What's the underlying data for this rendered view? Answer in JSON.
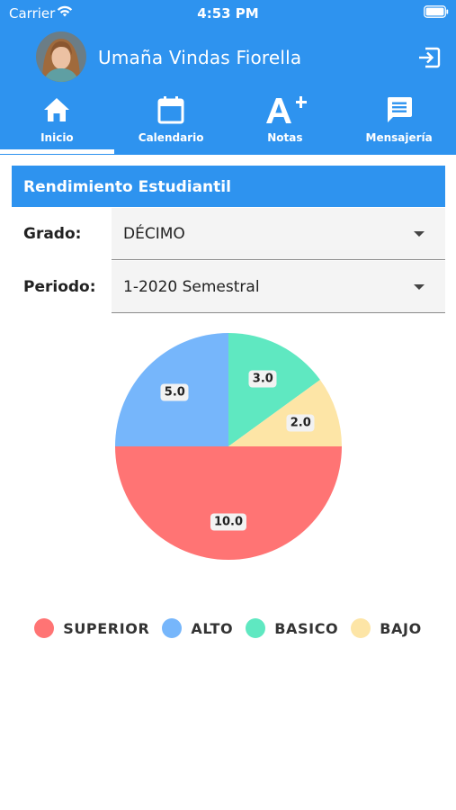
{
  "status_bar": {
    "carrier": "Carrier",
    "time": "4:53 PM"
  },
  "header": {
    "user_name": "Umaña Vindas Fiorella"
  },
  "tabs": [
    {
      "label": "Inicio",
      "icon": "home-icon",
      "active": true
    },
    {
      "label": "Calendario",
      "icon": "calendar-icon",
      "active": false
    },
    {
      "label": "Notas",
      "icon": "grades-icon",
      "active": false
    },
    {
      "label": "Mensajería",
      "icon": "message-icon",
      "active": false
    }
  ],
  "section": {
    "title": "Rendimiento Estudiantil"
  },
  "filters": {
    "grado": {
      "label": "Grado:",
      "value": "DÉCIMO"
    },
    "periodo": {
      "label": "Periodo:",
      "value": "1-2020 Semestral"
    }
  },
  "colors": {
    "primary": "#2e93ef",
    "superior": "#ff7474",
    "alto": "#76b6fb",
    "basico": "#5fe8c1",
    "bajo": "#fde5a6"
  },
  "chart_data": {
    "type": "pie",
    "slices": [
      {
        "name": "BASICO",
        "value": 3.0,
        "label": "3.0",
        "color": "#5fe8c1"
      },
      {
        "name": "BAJO",
        "value": 2.0,
        "label": "2.0",
        "color": "#fde5a6"
      },
      {
        "name": "SUPERIOR",
        "value": 10.0,
        "label": "10.0",
        "color": "#ff7474"
      },
      {
        "name": "ALTO",
        "value": 5.0,
        "label": "5.0",
        "color": "#76b6fb"
      }
    ],
    "legend": [
      "SUPERIOR",
      "ALTO",
      "BASICO",
      "BAJO"
    ],
    "legend_position": "bottom"
  }
}
